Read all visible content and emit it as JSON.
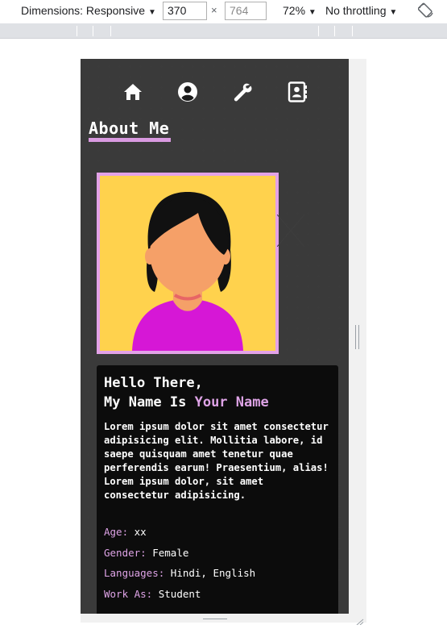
{
  "devtools": {
    "dimensions_label": "Dimensions: Responsive",
    "width": "370",
    "height": "764",
    "times": "×",
    "zoom": "72%",
    "throttling": "No throttling",
    "caret": "▼"
  },
  "nav": {
    "items": [
      {
        "icon": "home-icon"
      },
      {
        "icon": "user-circle-icon"
      },
      {
        "icon": "wrench-icon"
      },
      {
        "icon": "contact-book-icon"
      }
    ]
  },
  "about": {
    "title": "About Me",
    "hello_line": "Hello There,",
    "name_prefix": "My Name Is ",
    "name": "Your Name",
    "bio": "Lorem ipsum dolor sit amet consectetur adipisicing elit. Mollitia labore, id saepe quisquam amet tenetur quae perferendis earum! Praesentium, alias! Lorem ipsum dolor, sit amet consectetur adipisicing.",
    "details": [
      {
        "label": "Age:",
        "value": "xx"
      },
      {
        "label": "Gender:",
        "value": "Female"
      },
      {
        "label": "Languages:",
        "value": "Hindi, English"
      },
      {
        "label": "Work As:",
        "value": "Student"
      }
    ]
  },
  "colors": {
    "accent": "#dea3e6",
    "background": "#1b1b1b",
    "card": "#0c0c0c",
    "avatar_bg": "#ffd24d"
  }
}
